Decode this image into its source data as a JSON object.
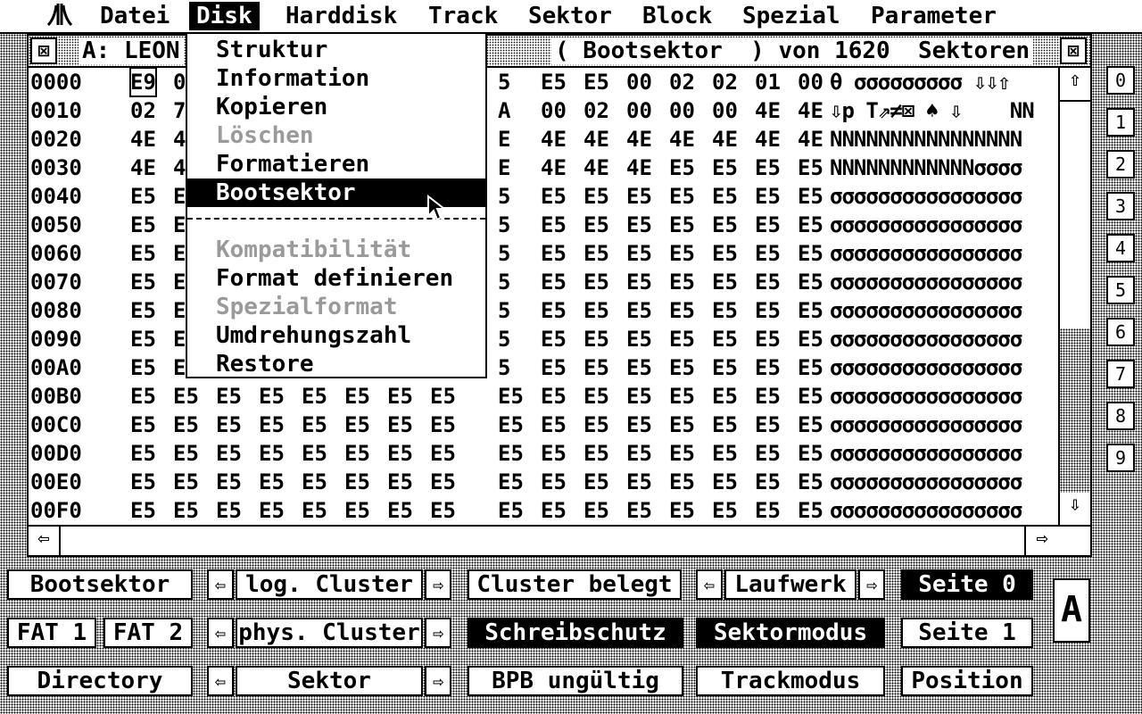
{
  "menubar": {
    "logo": "ATARI",
    "items": [
      "Datei",
      "Disk",
      "Harddisk",
      "Track",
      "Sektor",
      "Block",
      "Spezial",
      "Parameter"
    ],
    "active": "Disk"
  },
  "window": {
    "title_left": "A: LEON",
    "title_right": "( Bootsektor  ) von 1620  Sektoren"
  },
  "hex_rows": [
    {
      "addr": "0000",
      "bytes": [
        "E9",
        "0",
        "",
        "",
        "",
        "",
        "",
        "",
        "5",
        "E5",
        "E5",
        "00",
        "02",
        "02",
        "01",
        "00"
      ],
      "ascii": "θ σσσσσσσσσ ⇩⇩⇧"
    },
    {
      "addr": "0010",
      "bytes": [
        "02",
        "7",
        "",
        "",
        "",
        "",
        "",
        "",
        "A",
        "00",
        "02",
        "00",
        "00",
        "00",
        "4E",
        "4E"
      ],
      "ascii": "⇩p T⇗≠⊠ ♠ ⇩    NN"
    },
    {
      "addr": "0020",
      "bytes": [
        "4E",
        "4",
        "",
        "",
        "",
        "",
        "",
        "",
        "E",
        "4E",
        "4E",
        "4E",
        "4E",
        "4E",
        "4E",
        "4E"
      ],
      "ascii": "NNNNNNNNNNNNNNNN"
    },
    {
      "addr": "0030",
      "bytes": [
        "4E",
        "4",
        "",
        "",
        "",
        "",
        "",
        "",
        "E",
        "4E",
        "4E",
        "4E",
        "E5",
        "E5",
        "E5",
        "E5"
      ],
      "ascii": "NNNNNNNNNNNNσσσσ"
    },
    {
      "addr": "0040",
      "bytes": [
        "E5",
        "E",
        "",
        "",
        "",
        "",
        "",
        "",
        "5",
        "E5",
        "E5",
        "E5",
        "E5",
        "E5",
        "E5",
        "E5"
      ],
      "ascii": "σσσσσσσσσσσσσσσσ"
    },
    {
      "addr": "0050",
      "bytes": [
        "E5",
        "E",
        "",
        "",
        "",
        "",
        "",
        "",
        "5",
        "E5",
        "E5",
        "E5",
        "E5",
        "E5",
        "E5",
        "E5"
      ],
      "ascii": "σσσσσσσσσσσσσσσσ"
    },
    {
      "addr": "0060",
      "bytes": [
        "E5",
        "E",
        "",
        "",
        "",
        "",
        "",
        "",
        "5",
        "E5",
        "E5",
        "E5",
        "E5",
        "E5",
        "E5",
        "E5"
      ],
      "ascii": "σσσσσσσσσσσσσσσσ"
    },
    {
      "addr": "0070",
      "bytes": [
        "E5",
        "E",
        "",
        "",
        "",
        "",
        "",
        "",
        "5",
        "E5",
        "E5",
        "E5",
        "E5",
        "E5",
        "E5",
        "E5"
      ],
      "ascii": "σσσσσσσσσσσσσσσσ"
    },
    {
      "addr": "0080",
      "bytes": [
        "E5",
        "E",
        "",
        "",
        "",
        "",
        "",
        "",
        "5",
        "E5",
        "E5",
        "E5",
        "E5",
        "E5",
        "E5",
        "E5"
      ],
      "ascii": "σσσσσσσσσσσσσσσσ"
    },
    {
      "addr": "0090",
      "bytes": [
        "E5",
        "E",
        "",
        "",
        "",
        "",
        "",
        "",
        "5",
        "E5",
        "E5",
        "E5",
        "E5",
        "E5",
        "E5",
        "E5"
      ],
      "ascii": "σσσσσσσσσσσσσσσσ"
    },
    {
      "addr": "00A0",
      "bytes": [
        "E5",
        "E",
        "",
        "",
        "",
        "",
        "",
        "",
        "5",
        "E5",
        "E5",
        "E5",
        "E5",
        "E5",
        "E5",
        "E5"
      ],
      "ascii": "σσσσσσσσσσσσσσσσ"
    },
    {
      "addr": "00B0",
      "bytes": [
        "E5",
        "E5",
        "E5",
        "E5",
        "E5",
        "E5",
        "E5",
        "E5",
        "E5",
        "E5",
        "E5",
        "E5",
        "E5",
        "E5",
        "E5",
        "E5"
      ],
      "ascii": "σσσσσσσσσσσσσσσσ"
    },
    {
      "addr": "00C0",
      "bytes": [
        "E5",
        "E5",
        "E5",
        "E5",
        "E5",
        "E5",
        "E5",
        "E5",
        "E5",
        "E5",
        "E5",
        "E5",
        "E5",
        "E5",
        "E5",
        "E5"
      ],
      "ascii": "σσσσσσσσσσσσσσσσ"
    },
    {
      "addr": "00D0",
      "bytes": [
        "E5",
        "E5",
        "E5",
        "E5",
        "E5",
        "E5",
        "E5",
        "E5",
        "E5",
        "E5",
        "E5",
        "E5",
        "E5",
        "E5",
        "E5",
        "E5"
      ],
      "ascii": "σσσσσσσσσσσσσσσσ"
    },
    {
      "addr": "00E0",
      "bytes": [
        "E5",
        "E5",
        "E5",
        "E5",
        "E5",
        "E5",
        "E5",
        "E5",
        "E5",
        "E5",
        "E5",
        "E5",
        "E5",
        "E5",
        "E5",
        "E5"
      ],
      "ascii": "σσσσσσσσσσσσσσσσ"
    },
    {
      "addr": "00F0",
      "bytes": [
        "E5",
        "E5",
        "E5",
        "E5",
        "E5",
        "E5",
        "E5",
        "E5",
        "E5",
        "E5",
        "E5",
        "E5",
        "E5",
        "E5",
        "E5",
        "E5"
      ],
      "ascii": "σσσσσσσσσσσσσσσσ"
    }
  ],
  "scroll": {
    "up": "⇧",
    "down": "⇩",
    "left": "⇦",
    "right": "⇨"
  },
  "page_numbers": [
    "0",
    "1",
    "2",
    "3",
    "4",
    "5",
    "6",
    "7",
    "8",
    "9"
  ],
  "buttons": {
    "bootsektor": "Bootsektor",
    "fat1": "FAT 1",
    "fat2": "FAT 2",
    "directory": "Directory",
    "log_cluster": "log. Cluster",
    "phys_cluster": "phys. Cluster",
    "sektor": "Sektor",
    "cluster_belegt": "Cluster belegt",
    "schreibschutz": "Schreibschutz",
    "bpb_ungueltig": "BPB ungültig",
    "laufwerk": "Laufwerk",
    "sektormodus": "Sektormodus",
    "trackmodus": "Trackmodus",
    "seite0": "Seite 0",
    "seite1": "Seite 1",
    "position": "Position",
    "drive": "A",
    "arrow_left": "⇦",
    "arrow_right": "⇨"
  },
  "dropdown": {
    "items": [
      {
        "label": "Struktur",
        "state": "enabled"
      },
      {
        "label": "Information",
        "state": "enabled"
      },
      {
        "label": "Kopieren",
        "state": "enabled"
      },
      {
        "label": "Löschen",
        "state": "disabled"
      },
      {
        "label": "Formatieren",
        "state": "enabled"
      },
      {
        "label": "Bootsektor",
        "state": "selected"
      },
      {
        "label": "Kompatibilität",
        "state": "disabled"
      },
      {
        "label": "Format definieren",
        "state": "enabled"
      },
      {
        "label": "Spezialformat",
        "state": "disabled"
      },
      {
        "label": "Umdrehungszahl",
        "state": "enabled"
      },
      {
        "label": "Restore",
        "state": "enabled"
      }
    ]
  },
  "colors": {
    "foreground": "#000000",
    "background": "#ffffff",
    "disabled": "#9a9a9a"
  }
}
